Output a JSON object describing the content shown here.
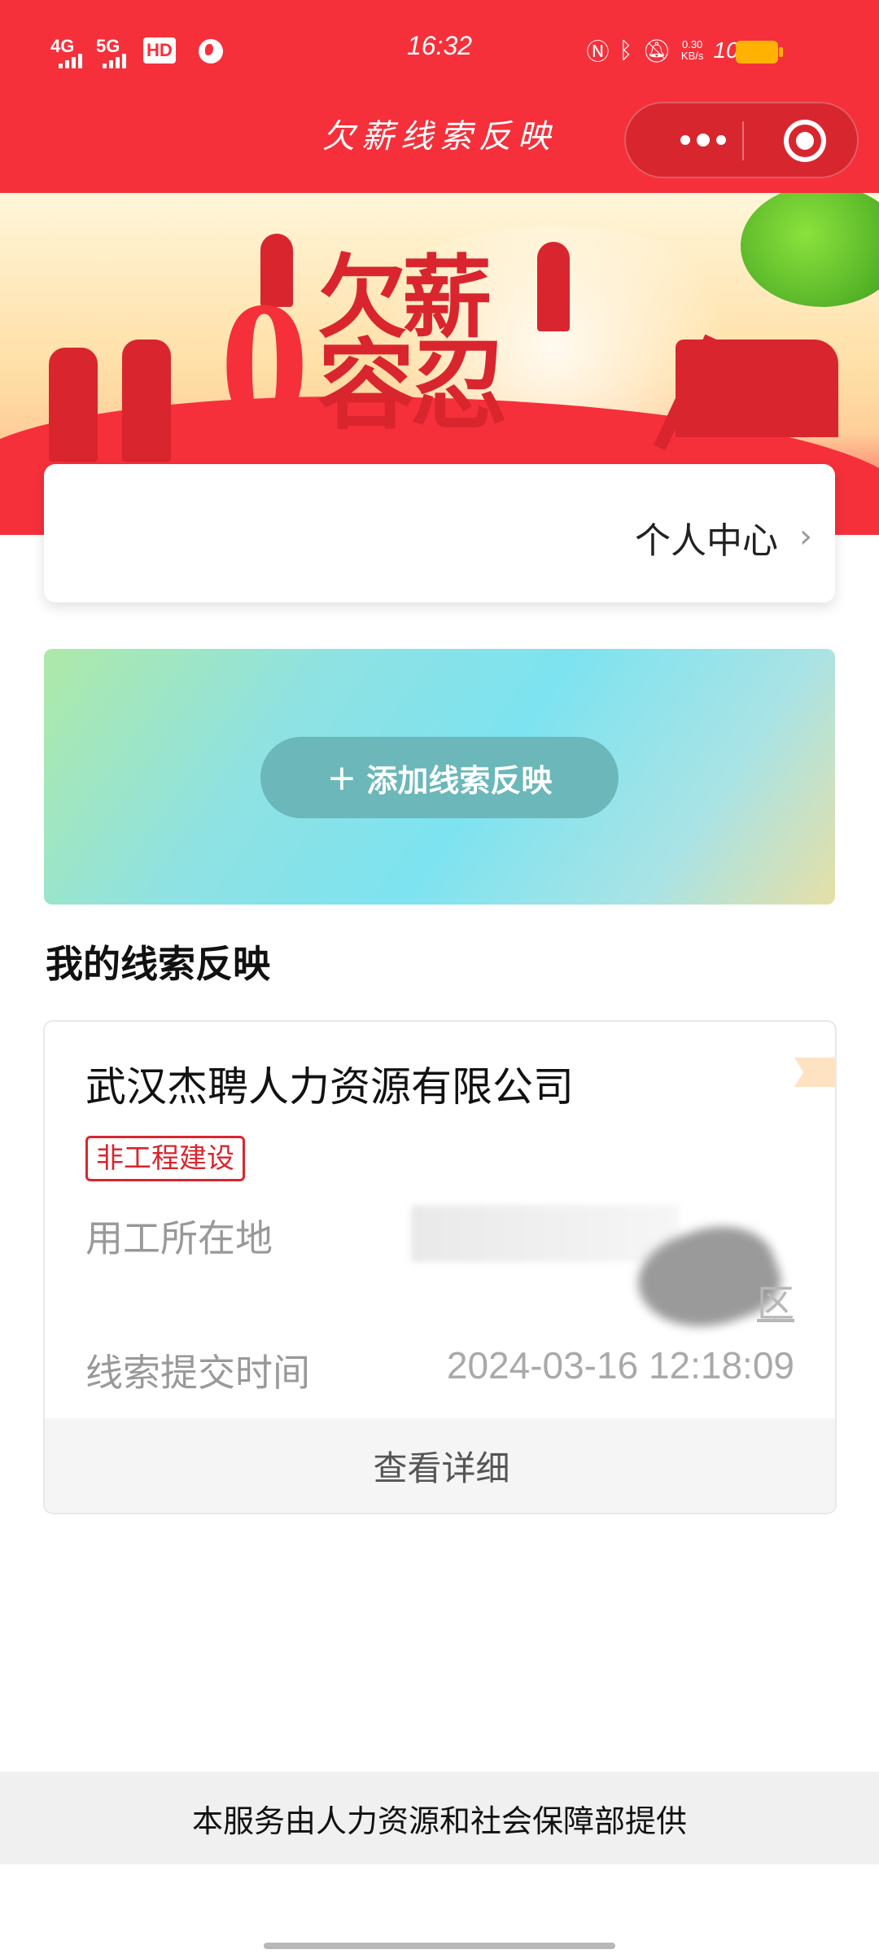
{
  "status_bar": {
    "network_1": "4G",
    "network_2": "5G",
    "hd": "HD",
    "time": "16:32",
    "speed_value": "0.30",
    "speed_unit": "KB/s",
    "battery_percent": "100%"
  },
  "nav": {
    "title": "欠薪线索反映",
    "more_icon": "more-dots-icon",
    "close_icon": "target-icon"
  },
  "banner": {
    "slogan_zero": "0",
    "slogan_line1": "欠薪",
    "slogan_line2": "容忍"
  },
  "personal_center": {
    "label": "个人中心",
    "chevron": "›"
  },
  "add_clue": {
    "plus": "+",
    "label": "添加线索反映"
  },
  "my_clues": {
    "title": "我的线索反映",
    "items": [
      {
        "company": "武汉杰聘人力资源有限公司",
        "tag": "非工程建设",
        "location_label": "用工所在地",
        "location_suffix": "区",
        "time_label": "线索提交时间",
        "time_value": "2024-03-16 12:18:09",
        "detail_button": "查看详细"
      }
    ]
  },
  "footer": {
    "text": "本服务由人力资源和社会保障部提供"
  },
  "colors": {
    "brand_red": "#f5303b",
    "tag_red": "#d9252e",
    "button_teal": "#6bb7b9"
  }
}
